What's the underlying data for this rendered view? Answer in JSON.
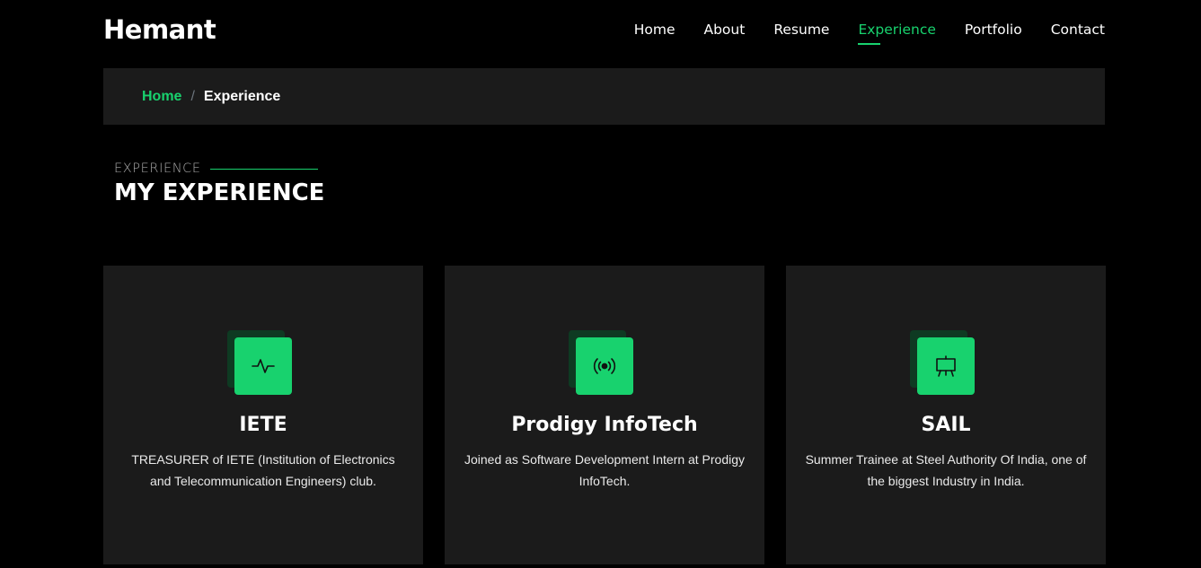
{
  "header": {
    "logo": "Hemant",
    "nav": [
      {
        "label": "Home"
      },
      {
        "label": "About"
      },
      {
        "label": "Resume"
      },
      {
        "label": "Experience"
      },
      {
        "label": "Portfolio"
      },
      {
        "label": "Contact"
      }
    ]
  },
  "breadcrumb": {
    "home": "Home",
    "separator": "/",
    "current": "Experience"
  },
  "section": {
    "subtitle": "EXPERIENCE",
    "title": "MY EXPERIENCE"
  },
  "cards": [
    {
      "title": "IETE",
      "description": "TREASURER of IETE (Institution of Electronics and Telecommunication Engineers) club.",
      "icon": "activity-icon"
    },
    {
      "title": "Prodigy InfoTech",
      "description": "Joined as Software Development Intern at Prodigy InfoTech.",
      "icon": "broadcast-icon"
    },
    {
      "title": "SAIL",
      "description": "Summer Trainee at Steel Authority Of India, one of the biggest Industry in India.",
      "icon": "easel-icon"
    }
  ],
  "colors": {
    "accent": "#18d26e",
    "background": "#000000",
    "card": "#1b1b1b"
  }
}
